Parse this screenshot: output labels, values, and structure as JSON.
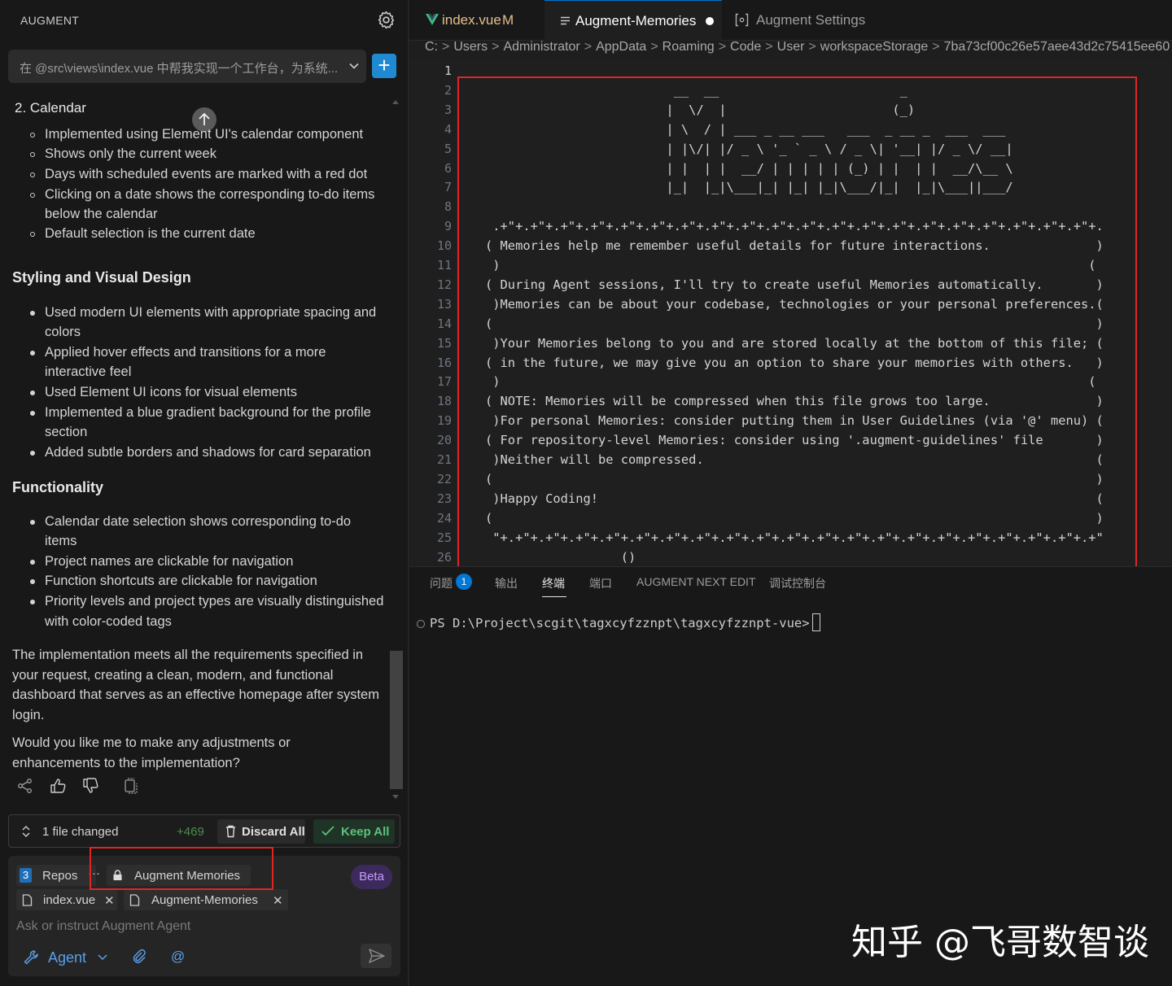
{
  "sidebar": {
    "title": "AUGMENT",
    "thread_title": "在 @src\\views\\index.vue 中帮我实现一个工作台，为系统...",
    "new_thread_label": "+"
  },
  "chat": {
    "calendar_heading": "2. Calendar",
    "calendar_items": [
      "Implemented using Element UI's calendar component",
      "Shows only the current week",
      "Days with scheduled events are marked with a red dot",
      "Clicking on a date shows the corresponding to-do items",
      "below the calendar",
      "Default selection is the current date"
    ],
    "styling_heading": "Styling and Visual Design",
    "styling_items": [
      "Used modern UI elements with appropriate spacing and",
      "colors",
      "Applied hover effects and transitions for a more",
      "interactive feel",
      "Used Element UI icons for visual elements",
      "Implemented a blue gradient background for the profile",
      "section",
      "Added subtle borders and shadows for card separation"
    ],
    "functionality_heading": "Functionality",
    "functionality_items": [
      "Calendar date selection shows corresponding to-do",
      "items",
      "Project names are clickable for navigation",
      "Function shortcuts are clickable for navigation",
      "Priority levels and project types are visually distinguished",
      "with color-coded tags"
    ],
    "summary_lines": [
      "The implementation meets all the requirements specified in",
      "your request, creating a clean, modern, and functional",
      "dashboard that serves as an effective homepage after system",
      "login."
    ],
    "question_lines": [
      "Would you like me to make any adjustments or",
      "enhancements to the implementation?"
    ]
  },
  "changes": {
    "label": "1 file changed",
    "count": "+469",
    "discard": "Discard All",
    "keep": "Keep All"
  },
  "composer": {
    "repos_count": "3",
    "repos_label": "Repos",
    "more": "···",
    "memories_chip": "Augment Memories",
    "beta": "Beta",
    "files": [
      "index.vue",
      "Augment-Memories"
    ],
    "placeholder": "Ask or instruct Augment Agent",
    "mode": "Agent",
    "mention": "@"
  },
  "tabs": {
    "index": {
      "label": "index.vue",
      "status": "M"
    },
    "memories": {
      "label": "Augment-Memories"
    },
    "settings": {
      "label": "Augment Settings"
    }
  },
  "breadcrumb": [
    "C:",
    "Users",
    "Administrator",
    "AppData",
    "Roaming",
    "Code",
    "User",
    "workspaceStorage",
    "7ba73cf00c26e57aee43d2c75415ee60"
  ],
  "editor": {
    "line_numbers": [
      "1",
      "2",
      "3",
      "4",
      "5",
      "6",
      "7",
      "8",
      "9",
      "10",
      "11",
      "12",
      "13",
      "14",
      "15",
      "16",
      "17",
      "18",
      "19",
      "20",
      "21",
      "22",
      "23",
      "24",
      "25",
      "26"
    ],
    "lines": [
      "",
      "                         __  __                        _",
      "                        |  \\/  |                      (_)",
      "                        | \\  / | ___ _ __ ___   ___  _ __ _  ___  ___",
      "                        | |\\/| |/ _ \\ '_ ` _ \\ / _ \\| '__| |/ _ \\/ __|",
      "                        | |  | |  __/ | | | | | (_) | |  | |  __/\\__ \\",
      "                        |_|  |_|\\___|_| |_| |_|\\___/|_|  |_|\\___||___/",
      "",
      " .+\"+.+\"+.+\"+.+\"+.+\"+.+\"+.+\"+.+\"+.+\"+.+\"+.+\"+.+\"+.+\"+.+\"+.+\"+.+\"+.+\"+.+\"+.+\"+.+\"+.",
      "( Memories help me remember useful details for future interactions.              )",
      " )                                                                              (",
      "( During Agent sessions, I'll try to create useful Memories automatically.       )",
      " )Memories can be about your codebase, technologies or your personal preferences.(",
      "(                                                                                )",
      " )Your Memories belong to you and are stored locally at the bottom of this file; (",
      "( in the future, we may give you an option to share your memories with others.   )",
      " )                                                                              (",
      "( NOTE: Memories will be compressed when this file grows too large.              )",
      " )For personal Memories: consider putting them in User Guidelines (via '@' menu) (",
      "( For repository-level Memories: consider using '.augment-guidelines' file       )",
      " )Neither will be compressed.                                                    (",
      "(                                                                                )",
      " )Happy Coding!                                                                  (",
      "(                                                                                )",
      " \"+.+\"+.+\"+.+\"+.+\"+.+\"+.+\"+.+\"+.+\"+.+\"+.+\"+.+\"+.+\"+.+\"+.+\"+.+\"+.+\"+.+\"+.+\"+.+\"+.+\"",
      "                  ()"
    ]
  },
  "panel": {
    "tabs": [
      "问题",
      "输出",
      "终端",
      "端口",
      "AUGMENT NEXT EDIT",
      "调试控制台"
    ],
    "problems_badge": "1",
    "terminal_prompt": "PS D:\\Project\\scgit\\tagxcyfzznpt\\tagxcyfzznpt-vue>"
  },
  "watermark": "知乎 @飞哥数智谈",
  "colors": {
    "accent": "#0078d4",
    "highlight_box": "#e02525",
    "keep_green": "#5cc27a",
    "beta_purple": "#c49cf7",
    "modified_orange": "#e2c08d"
  }
}
